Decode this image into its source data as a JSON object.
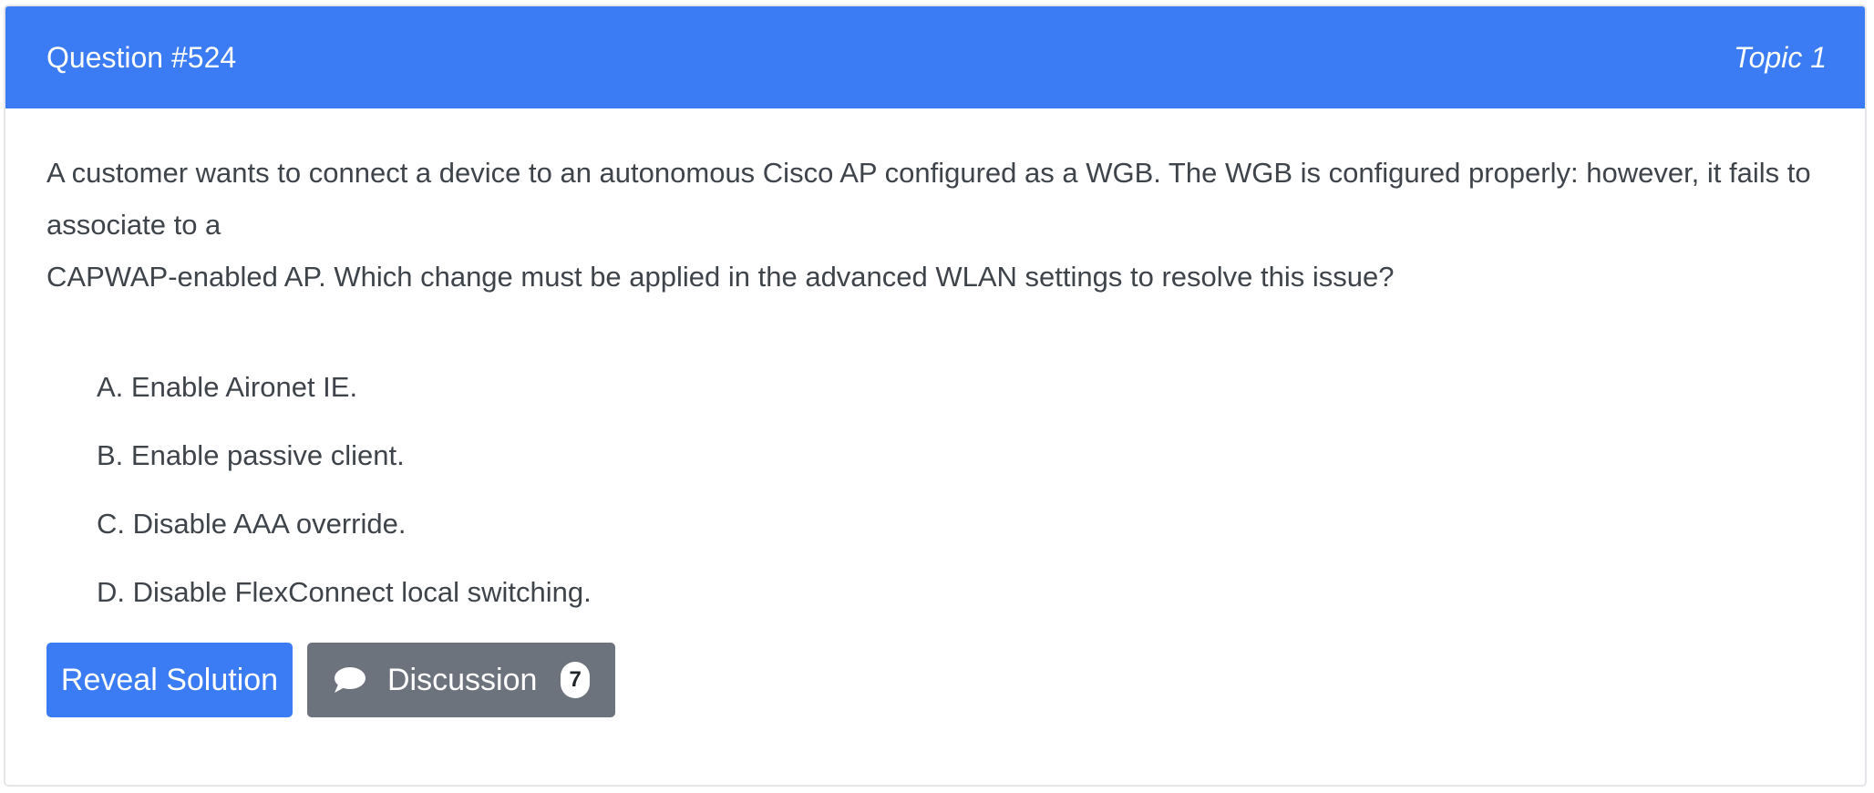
{
  "header": {
    "question_number": "Question #524",
    "topic": "Topic 1"
  },
  "question": {
    "line1": "A customer wants to connect a device to an autonomous Cisco AP configured as a WGB. The WGB is configured properly: however, it fails to associate to a",
    "line2": "CAPWAP-enabled AP. Which change must be applied in the advanced WLAN settings to resolve this issue?"
  },
  "choices": [
    {
      "label": "A. Enable Aironet IE."
    },
    {
      "label": "B. Enable passive client."
    },
    {
      "label": "C. Disable AAA override."
    },
    {
      "label": "D. Disable FlexConnect local switching."
    }
  ],
  "buttons": {
    "reveal_label": "Reveal Solution",
    "discussion_label": "Discussion",
    "discussion_count": "7",
    "discussion_icon": "chat-bubble-icon"
  },
  "colors": {
    "header_bg": "#3b7cf4",
    "reveal_bg": "#3b7cf4",
    "discussion_bg": "#6c737c"
  }
}
